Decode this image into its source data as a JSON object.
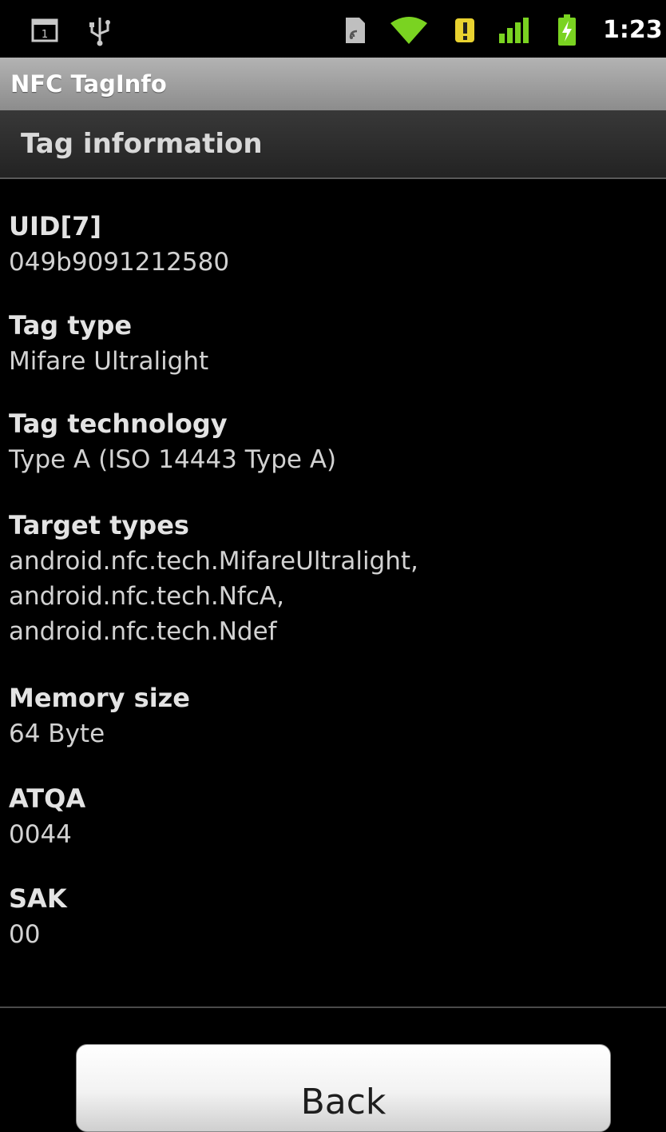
{
  "status_bar": {
    "time": "1:23",
    "icons": [
      "notification-window-icon",
      "usb-icon",
      "sim-card-icon",
      "wifi-icon",
      "alert-icon",
      "signal-icon",
      "battery-charging-icon"
    ],
    "accent_green": "#7ad321",
    "alert_yellow": "#e9d230"
  },
  "title_bar": {
    "title": "NFC TagInfo"
  },
  "section": {
    "title": "Tag information"
  },
  "fields": [
    {
      "label": "UID[7]",
      "value": "049b9091212580"
    },
    {
      "label": "Tag type",
      "value": "Mifare Ultralight"
    },
    {
      "label": "Tag technology",
      "value": "Type A (ISO 14443 Type A)"
    },
    {
      "label": "Target types",
      "value": "android.nfc.tech.MifareUltralight,\nandroid.nfc.tech.NfcA,\nandroid.nfc.tech.Ndef"
    },
    {
      "label": "Memory size",
      "value": "64 Byte"
    },
    {
      "label": "ATQA",
      "value": "0044"
    },
    {
      "label": "SAK",
      "value": "00"
    }
  ],
  "buttons": {
    "back_label": "Back"
  }
}
